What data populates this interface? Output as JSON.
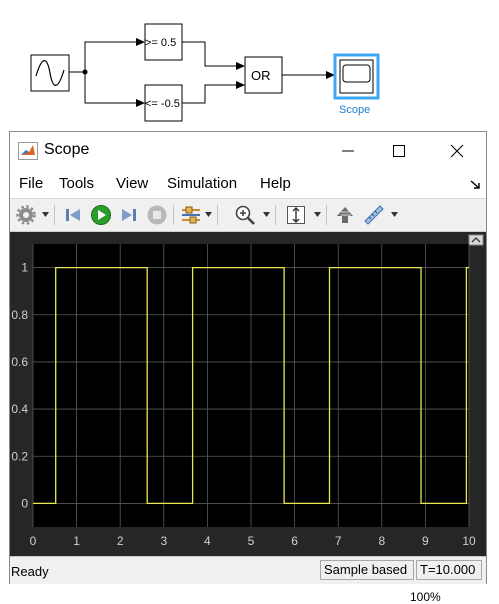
{
  "diagram": {
    "compare_top_label": ">= 0.5",
    "compare_bottom_label": "<= -0.5",
    "logic_label": "OR",
    "scope_block_name": "Scope",
    "scope_label_color": "#1a7fd0"
  },
  "window": {
    "title": "Scope",
    "controls": [
      "minimize-icon",
      "maximize-icon",
      "close-icon"
    ]
  },
  "menu": {
    "file": "File",
    "tools": "Tools",
    "view": "View",
    "simulation": "Simulation",
    "help": "Help"
  },
  "toolbar": {
    "icons": [
      "gear-icon",
      "step-back-icon",
      "run-icon",
      "step-forward-icon",
      "stop-icon",
      "cursor-measure-icon",
      "zoom-in-icon",
      "autoscale-icon",
      "highlight-simulink-icon",
      "ruler-icon"
    ]
  },
  "status": {
    "ready": "Ready",
    "sample_mode": "Sample based",
    "time": "T=10.000"
  },
  "below_window_text": "100%",
  "colors": {
    "plot_background": "#000000",
    "plot_frame": "#262626",
    "grid": "#5a5a5a",
    "trace": "#e8e850",
    "tick_text": "#d0d0d0"
  },
  "chart_data": {
    "type": "line",
    "title": "",
    "xlabel": "",
    "ylabel": "",
    "xlim": [
      0,
      10
    ],
    "ylim": [
      -0.1,
      1.1
    ],
    "xticks": [
      "0",
      "1",
      "2",
      "3",
      "4",
      "5",
      "6",
      "7",
      "8",
      "9",
      "10"
    ],
    "yticks": [
      "0",
      "0.2",
      "0.4",
      "0.6",
      "0.8",
      "1"
    ],
    "grid": true,
    "legend": "none",
    "series": [
      {
        "x": [
          0,
          0.52,
          0.52,
          2.62,
          2.62,
          3.66,
          3.66,
          5.76,
          5.76,
          6.8,
          6.8,
          8.9,
          8.9,
          9.94,
          9.94,
          10
        ],
        "y": [
          0,
          0,
          1,
          1,
          0,
          0,
          1,
          1,
          0,
          0,
          1,
          1,
          0,
          0,
          1,
          1
        ]
      }
    ]
  }
}
